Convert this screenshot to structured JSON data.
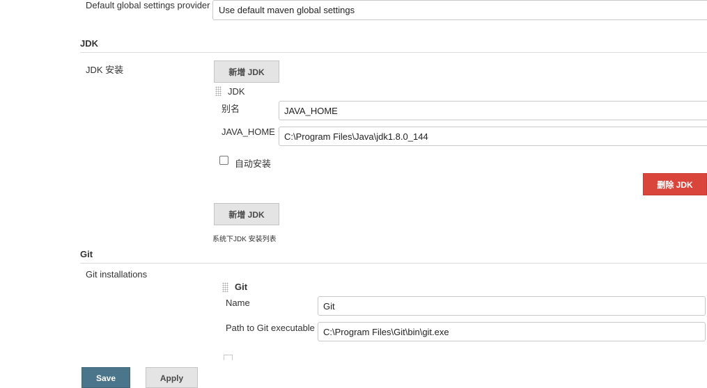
{
  "maven": {
    "global_settings_label": "Default global settings provider",
    "global_settings_value": "Use default maven global settings"
  },
  "jdk": {
    "section_title": "JDK",
    "install_label": "JDK 安装",
    "add_button": "新增 JDK",
    "item_title": "JDK",
    "alias_label": "别名",
    "alias_value": "JAVA_HOME",
    "java_home_label": "JAVA_HOME",
    "java_home_value": "C:\\Program Files\\Java\\jdk1.8.0_144",
    "auto_install_label": "自动安装",
    "delete_button": "删除 JDK",
    "add_button_2": "新增 JDK",
    "list_hint": "系统下JDK 安装列表"
  },
  "git": {
    "section_title": "Git",
    "installations_label": "Git installations",
    "item_title": "Git",
    "name_label": "Name",
    "name_value": "Git",
    "path_label": "Path to Git executable",
    "path_value": "C:\\Program Files\\Git\\bin\\git.exe"
  },
  "footer": {
    "save_label": "Save",
    "apply_label": "Apply"
  },
  "colors": {
    "delete_button": "#d9453b",
    "save_button": "#4b758b"
  }
}
